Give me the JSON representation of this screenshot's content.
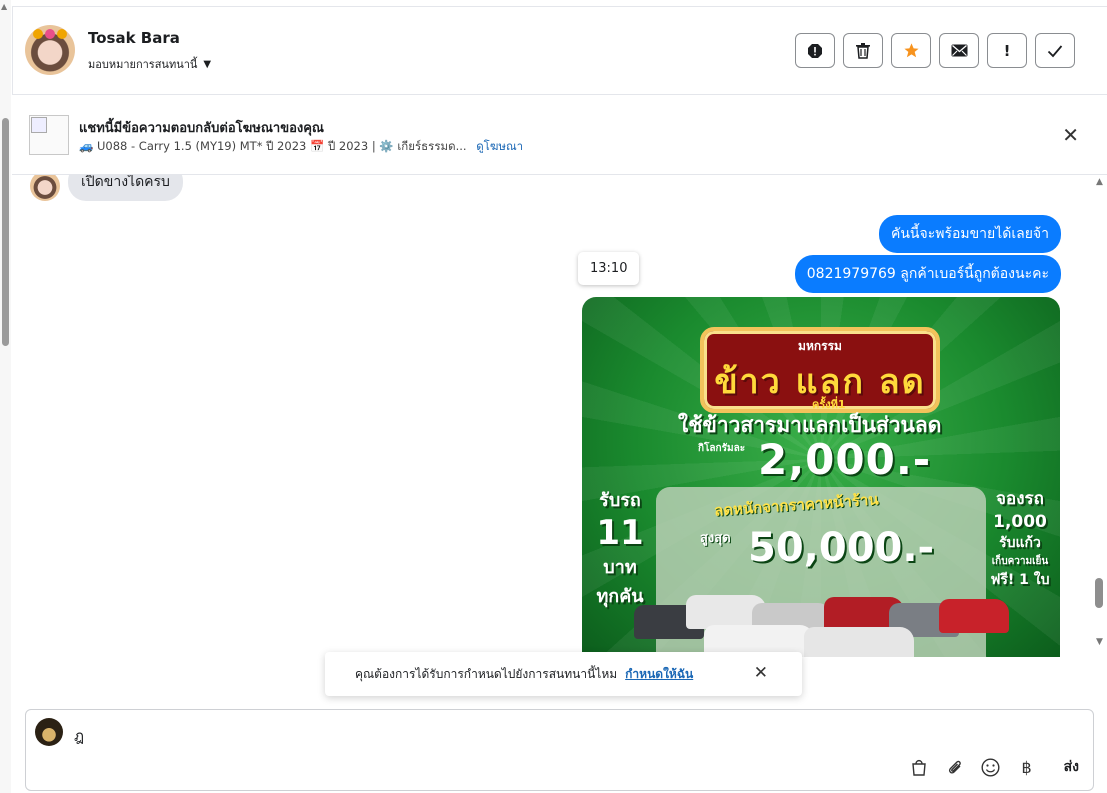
{
  "conversation": {
    "user_name": "Tosak Bara",
    "assign_label": "มอบหมายการสนทนานี้"
  },
  "actions": [
    {
      "name": "flag-button",
      "glyph": "⬤"
    },
    {
      "name": "delete-button",
      "glyph": "🗑"
    },
    {
      "name": "star-button",
      "glyph": "★"
    },
    {
      "name": "mail-button",
      "glyph": "✉"
    },
    {
      "name": "important-button",
      "glyph": "!"
    },
    {
      "name": "done-button",
      "glyph": "✓"
    }
  ],
  "banner": {
    "title": "แชทนี้มีข้อความตอบกลับต่อโฆษณาของคุณ",
    "subtitle": "🚙 U088 - Carry 1.5 (MY19) MT* ปี 2023 📅 ปี 2023 | ⚙️ เกียร์ธรรมด...",
    "link": "ดูโฆษณา"
  },
  "messages": {
    "incoming": "เปิดขางไดครบ",
    "outgoing_1": "คันนี้จะพร้อมขายได้เลยจ้า",
    "outgoing_2": "0821979769 ลูกค้าเบอร์นี้ถูกต้องนะคะ",
    "time": "13:10"
  },
  "promo": {
    "small": "มหกรรม",
    "big": "ข้าว แลก ลด",
    "times": "ครั้งที่1",
    "headline": "ใช้ข้าวสารมาแลกเป็นส่วนลด",
    "per_kg": "กิโลกรัมละ",
    "price1": "2,000.-",
    "panel_title": "ลดหนักจากราคาหน้าร้าน",
    "upto": "สูงสุด",
    "price2": "50,000.-",
    "left": [
      "รับรถ",
      "11",
      "บาท",
      "ทุกคัน"
    ],
    "right": [
      "จองรถ",
      "1,000",
      "รับแก้ว",
      "เก็บความเย็น",
      "ฟรี! 1 ใบ"
    ]
  },
  "toast": {
    "text": "คุณต้องการได้รับการกำหนดไปยังการสนทนานี้ไหม",
    "link": "กำหนดให้ฉัน"
  },
  "composer": {
    "value": "ฎ",
    "send_label": "ส่ง"
  },
  "colors": {
    "accent": "#0a7cff",
    "link": "#1a67b5",
    "star": "#f7931e"
  }
}
